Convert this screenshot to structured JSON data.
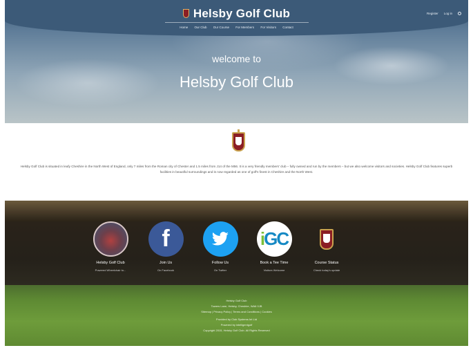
{
  "header": {
    "site_title": "Helsby Golf Club",
    "nav": [
      "Home",
      "Our Club",
      "Our Course",
      "For Members",
      "For Visitors",
      "Contact"
    ],
    "util": {
      "register": "Register",
      "login": "Log in"
    }
  },
  "hero": {
    "welcome": "welcome to",
    "club_name": "Helsby Golf Club"
  },
  "intro": {
    "text": "Helsby Golf Club is situated in leafy Cheshire in the North West of England, only 7 miles from the Roman city of Chester and 1.5 miles from J14 of the M56. It is a very friendly members' club – fully owned and run by the members – but we also welcome visitors and societies. Helsby Golf Club features superb facilities in beautiful surroundings and is now regarded as one of golf's finest in Cheshire and the North West."
  },
  "social": [
    {
      "title": "Helsby Golf Club",
      "subtitle": "Powered Wheelchair to..."
    },
    {
      "title": "Join Us",
      "subtitle": "On Facebook",
      "icon": "facebook-icon",
      "glyph": "f"
    },
    {
      "title": "Follow Us",
      "subtitle": "On Twitter",
      "icon": "twitter-icon"
    },
    {
      "title": "Book a Tee Time",
      "subtitle": "Visitors Welcome",
      "icon": "igc-logo",
      "logo_a": "i",
      "logo_b": "G",
      "logo_c": "C"
    },
    {
      "title": "Course Status",
      "subtitle": "Check today's update"
    }
  ],
  "footer": {
    "name": "Helsby Golf Club",
    "address": "Towers Lane, Helsby, Cheshire, WA6 0JB",
    "links": "Sitemap | Privacy Policy | Terms and Conditions | Cookies",
    "provided": "Provided by Club Systems Int Ltd",
    "powered": "Powered by intelligentgolf",
    "copyright": "Copyright 2015, Helsby Golf Club. All Rights Reserved"
  },
  "colors": {
    "header": "#3c5a78",
    "facebook": "#3b5998",
    "twitter": "#1da1f2",
    "crest": "#8b1e24"
  }
}
